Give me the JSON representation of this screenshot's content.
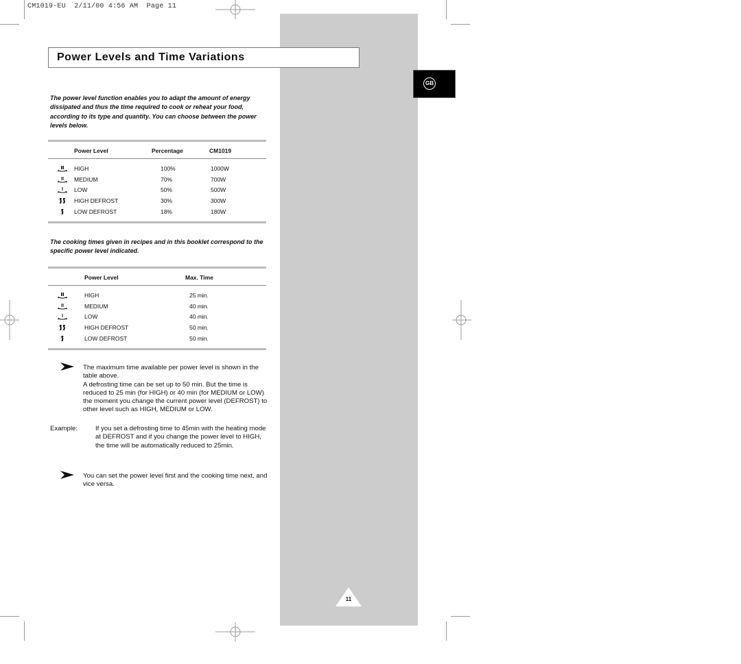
{
  "print_header": "CM1019-EU  2/11/00 4:56 AM  Page 11",
  "title": "Power Levels and Time Variations",
  "language_badge": "GB",
  "intro": "The power level function enables you to adapt the amount of energy dissipated and thus the time required to cook or reheat your food, according to its type and quantity. You can choose between the power levels below.",
  "table1": {
    "headers": [
      "Power Level",
      "Percentage",
      "CM1019"
    ],
    "rows": [
      {
        "icon": "power-high-icon",
        "level": "HIGH",
        "percentage": "100%",
        "watts": "1000W"
      },
      {
        "icon": "power-medium-icon",
        "level": "MEDIUM",
        "percentage": "70%",
        "watts": "700W"
      },
      {
        "icon": "power-low-icon",
        "level": "LOW",
        "percentage": "50%",
        "watts": "500W"
      },
      {
        "icon": "high-defrost-icon",
        "level": "HIGH DEFROST",
        "percentage": "30%",
        "watts": "300W"
      },
      {
        "icon": "low-defrost-icon",
        "level": "LOW DEFROST",
        "percentage": "18%",
        "watts": "180W"
      }
    ]
  },
  "para2": "The cooking times given in recipes and in this booklet correspond to the specific power level indicated.",
  "table2": {
    "headers": [
      "Power Level",
      "Max. Time"
    ],
    "rows": [
      {
        "icon": "power-high-icon",
        "level": "HIGH",
        "max_time": "25 min."
      },
      {
        "icon": "power-medium-icon",
        "level": "MEDIUM",
        "max_time": "40 min."
      },
      {
        "icon": "power-low-icon",
        "level": "LOW",
        "max_time": "40 min."
      },
      {
        "icon": "high-defrost-icon",
        "level": "HIGH DEFROST",
        "max_time": "50 min."
      },
      {
        "icon": "low-defrost-icon",
        "level": "LOW DEFROST",
        "max_time": "50 min."
      }
    ]
  },
  "note1": {
    "icon": "arrow-pointer-icon",
    "line1": "The maximum time available per power level is shown in the table above.",
    "line2": "A defrosting time can be set up to 50 min. But the time is reduced to 25 min (for HIGH) or 40 min (for MEDIUM or LOW) the moment you change the current power level (DEFROST) to other level such as HIGH, MEDIUM or LOW."
  },
  "example": {
    "label": "Example:",
    "text": "If you set a defrosting time to 45min with the heating mode at DEFROST and if you change the power level to HIGH, the time will be automatically reduced to 25min."
  },
  "note2": {
    "icon": "arrow-pointer-icon",
    "text": "You can set the power level first and the cooking time next, and vice versa."
  },
  "page_number": "11"
}
